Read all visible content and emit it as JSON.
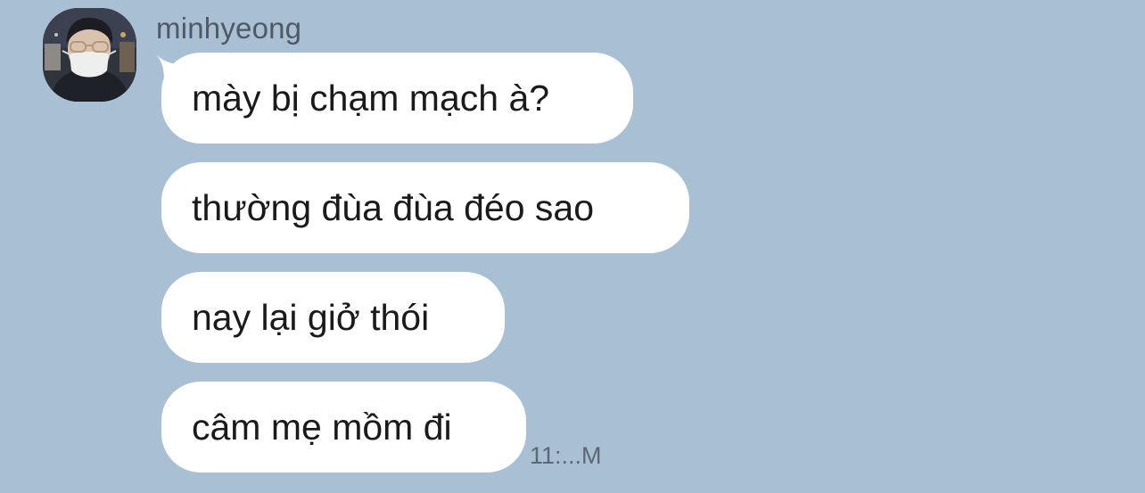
{
  "sender": {
    "name": "minhyeong",
    "avatar_icon": "profile-photo-icon"
  },
  "messages": [
    {
      "text": "mày bị chạm mạch à?"
    },
    {
      "text": "thường đùa đùa đéo sao"
    },
    {
      "text": "nay lại giở thói"
    },
    {
      "text": "câm mẹ mồm đi"
    }
  ],
  "timestamp": "11:...M",
  "colors": {
    "background": "#a9bfd3",
    "bubble": "#ffffff",
    "text": "#1a1a1a",
    "name": "#4f5964",
    "timestamp": "#5e6771"
  }
}
